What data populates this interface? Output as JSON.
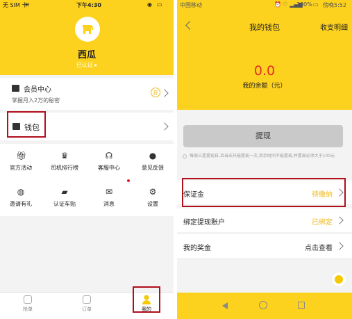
{
  "left": {
    "status": {
      "carrier": "无 SIM 卡",
      "time": "下午4:30"
    },
    "profile": {
      "name": "西瓜",
      "verified": "已认证 ▸"
    },
    "vip": {
      "title": "会员中心",
      "subtitle": "掌握月入2万的秘密",
      "badge": "荐"
    },
    "wallet": {
      "label": "钱包"
    },
    "grid": [
      {
        "label": "官方活动",
        "icon": "gift-icon"
      },
      {
        "label": "司机排行榜",
        "icon": "trophy-icon"
      },
      {
        "label": "客服中心",
        "icon": "headset-icon"
      },
      {
        "label": "意见反馈",
        "icon": "chat-icon"
      },
      {
        "label": "邀请有礼",
        "icon": "money-bag-icon"
      },
      {
        "label": "认证车贴",
        "icon": "truck-icon"
      },
      {
        "label": "消息",
        "icon": "mail-icon"
      },
      {
        "label": "设置",
        "icon": "gear-icon"
      }
    ],
    "tabs": [
      {
        "label": "抢单",
        "icon": "grab-order-icon"
      },
      {
        "label": "订单",
        "icon": "order-icon"
      },
      {
        "label": "我的",
        "icon": "person-icon"
      }
    ]
  },
  "right": {
    "status": {
      "carrier": "中国移动",
      "battery": "100%",
      "time": "傍晚5:52"
    },
    "header": {
      "title": "我的钱包",
      "detail": "收支明细"
    },
    "balance": {
      "amount": "0.0",
      "label": "我的余额（元）"
    },
    "withdraw_label": "提现",
    "notice": "每周三是提现日,且当天只能提现一次,其余时间不能提现,并提现必须大于100元",
    "rows": [
      {
        "key": "保证金",
        "value": "待缴纳",
        "color": "#f0b818"
      },
      {
        "key": "绑定提现账户",
        "value": "已绑定",
        "color": "#f0b818"
      },
      {
        "key": "我的奖金",
        "value": "点击查看",
        "color": "#333333"
      }
    ]
  },
  "colors": {
    "accent": "#fdd21e",
    "highlight_box": "#b00e1a",
    "balance": "#e03024"
  }
}
